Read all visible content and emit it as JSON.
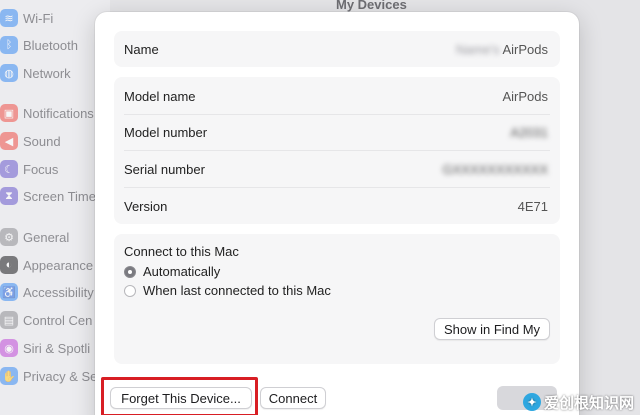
{
  "sidebar": {
    "items": [
      {
        "label": "Wi-Fi",
        "icon": "wifi-icon",
        "color": "#3b8cf3"
      },
      {
        "label": "Bluetooth",
        "icon": "bluetooth-icon",
        "color": "#3b8cf3"
      },
      {
        "label": "Network",
        "icon": "network-icon",
        "color": "#3b8cf3"
      },
      {
        "label": "Notifications",
        "icon": "notifications-icon",
        "color": "#f05048"
      },
      {
        "label": "Sound",
        "icon": "sound-icon",
        "color": "#f05048"
      },
      {
        "label": "Focus",
        "icon": "focus-icon",
        "color": "#6a5acd"
      },
      {
        "label": "Screen Time",
        "icon": "screen-time-icon",
        "color": "#6a5acd"
      },
      {
        "label": "General",
        "icon": "general-icon",
        "color": "#8e8e93"
      },
      {
        "label": "Appearance",
        "icon": "appearance-icon",
        "color": "#1d1d1f"
      },
      {
        "label": "Accessibility",
        "icon": "accessibility-icon",
        "color": "#3b8cf3"
      },
      {
        "label": "Control Cen",
        "icon": "control-center-icon",
        "color": "#8e8e93"
      },
      {
        "label": "Siri & Spotli",
        "icon": "siri-icon",
        "color": "#c04ad8"
      },
      {
        "label": "Privacy & Se",
        "icon": "privacy-icon",
        "color": "#3b8cf3"
      }
    ]
  },
  "background": {
    "title": "My Devices"
  },
  "dialog": {
    "name_label": "Name",
    "name_value_blurred": "Name's",
    "name_value": "AirPods",
    "model_name_label": "Model name",
    "model_name_value": "AirPods",
    "model_number_label": "Model number",
    "model_number_value": "A2031",
    "serial_number_label": "Serial number",
    "serial_number_value": "GXXXXXXXXXXX",
    "version_label": "Version",
    "version_value": "4E71",
    "connect_title": "Connect to this Mac",
    "option_automatically": "Automatically",
    "option_last_connected": "When last connected to this Mac",
    "show_find_my": "Show in Find My",
    "forget_device": "Forget This Device...",
    "connect": "Connect"
  },
  "watermark": {
    "text": "爱创根知识网"
  },
  "colors": {
    "highlight": "#d81e24",
    "accent": "#3b8cf3"
  }
}
